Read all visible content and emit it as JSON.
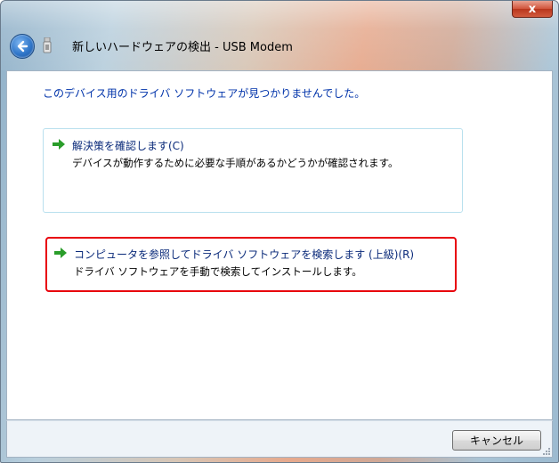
{
  "window": {
    "title": "新しいハードウェアの検出 - USB Modem",
    "close_label": "x"
  },
  "content": {
    "heading": "このデバイス用のドライバ ソフトウェアが見つかりませんでした。",
    "options": [
      {
        "title": "解決策を確認します(C)",
        "description": "デバイスが動作するために必要な手順があるかどうかが確認されます。"
      },
      {
        "title": "コンピュータを参照してドライバ ソフトウェアを検索します (上級)(R)",
        "description": "ドライバ ソフトウェアを手動で検索してインストールします。"
      }
    ]
  },
  "footer": {
    "cancel_label": "キャンセル"
  },
  "colors": {
    "link_blue": "#0033aa",
    "highlight_red": "#e8000b",
    "arrow_green": "#2a9d2a"
  },
  "icons": {
    "back": "back-arrow-icon",
    "usb": "usb-device-icon",
    "option_arrow": "green-arrow-icon"
  }
}
